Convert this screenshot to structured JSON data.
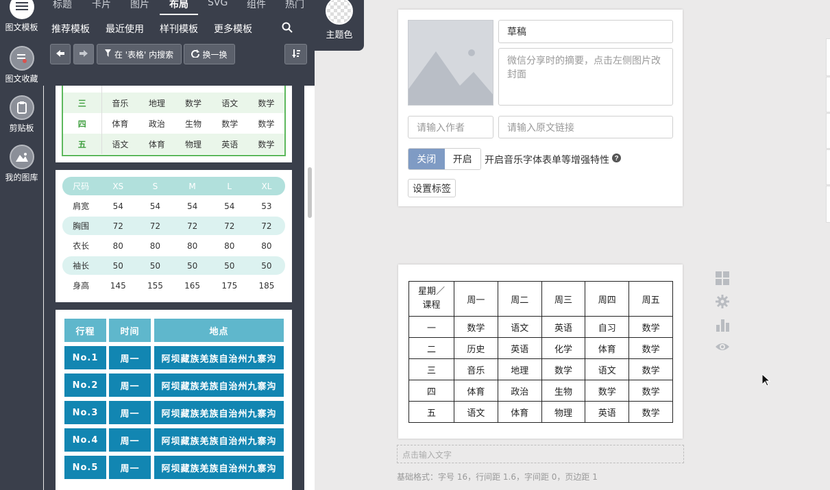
{
  "rail": [
    {
      "label": "图文模板",
      "icon": "list-icon"
    },
    {
      "label": "图文收藏",
      "icon": "favorites-icon"
    },
    {
      "label": "剪贴板",
      "icon": "clipboard-icon"
    },
    {
      "label": "我的图库",
      "icon": "gallery-icon"
    }
  ],
  "tabs": [
    "标题",
    "卡片",
    "图片",
    "布局",
    "SVG",
    "组件",
    "热门"
  ],
  "active_tab": "布局",
  "subnav": [
    "推荐模板",
    "最近使用",
    "样刊模板",
    "更多模板"
  ],
  "toolbar": {
    "search_in": "在 '表格' 内搜索",
    "shuffle": "换一换"
  },
  "theme_label": "主题色",
  "green_table": [
    [
      "三",
      "音乐",
      "地理",
      "数学",
      "语文",
      "数学"
    ],
    [
      "四",
      "体育",
      "政治",
      "生物",
      "数学",
      "数学"
    ],
    [
      "五",
      "语文",
      "体育",
      "物理",
      "英语",
      "数学"
    ]
  ],
  "size_table": {
    "header": [
      "尺码",
      "XS",
      "S",
      "M",
      "L",
      "XL"
    ],
    "rows": [
      [
        "肩宽",
        "54",
        "54",
        "54",
        "54",
        "53"
      ],
      [
        "胸围",
        "72",
        "72",
        "72",
        "72",
        "72"
      ],
      [
        "衣长",
        "80",
        "80",
        "80",
        "80",
        "80"
      ],
      [
        "袖长",
        "50",
        "50",
        "50",
        "50",
        "50"
      ],
      [
        "身高",
        "145",
        "155",
        "165",
        "175",
        "185"
      ]
    ]
  },
  "trip_table": {
    "header": [
      "行程",
      "时间",
      "地点"
    ],
    "rows": [
      [
        "No.1",
        "周一",
        "阿坝藏族羌族自治州九寨沟"
      ],
      [
        "No.2",
        "周一",
        "阿坝藏族羌族自治州九寨沟"
      ],
      [
        "No.3",
        "周一",
        "阿坝藏族羌族自治州九寨沟"
      ],
      [
        "No.4",
        "周一",
        "阿坝藏族羌族自治州九寨沟"
      ],
      [
        "No.5",
        "周一",
        "阿坝藏族羌族自治州九寨沟"
      ]
    ]
  },
  "article": {
    "title_value": "草稿",
    "summary_placeholder": "微信分享时的摘要，点击左侧图片改封面",
    "author_placeholder": "请输入作者",
    "link_placeholder": "请输入原文链接",
    "toggle_off": "关闭",
    "toggle_on": "开启",
    "toggle_desc": "开启音乐字体表单等增强特性",
    "tag_button": "设置标签"
  },
  "schedule": {
    "header": [
      "星期／课程",
      "周一",
      "周二",
      "周三",
      "周四",
      "周五"
    ],
    "rows": [
      [
        "一",
        "数学",
        "语文",
        "英语",
        "自习",
        "数学"
      ],
      [
        "二",
        "历史",
        "英语",
        "化学",
        "体育",
        "数学"
      ],
      [
        "三",
        "音乐",
        "地理",
        "数学",
        "语文",
        "数学"
      ],
      [
        "四",
        "体育",
        "政治",
        "生物",
        "数学",
        "数学"
      ],
      [
        "五",
        "语文",
        "体育",
        "物理",
        "英语",
        "数学"
      ]
    ]
  },
  "text_placeholder": "点击输入文字",
  "base_format": "基础格式：字号 16，行间距 1.6，字间距 0，页边距 1",
  "colors": {
    "sidebar": "#3a3f4b",
    "toggle_active": "#7f9bc4",
    "green_accent": "#3f9f3f",
    "teal_head": "#5fb7cc",
    "teal_body": "#1286b2"
  }
}
